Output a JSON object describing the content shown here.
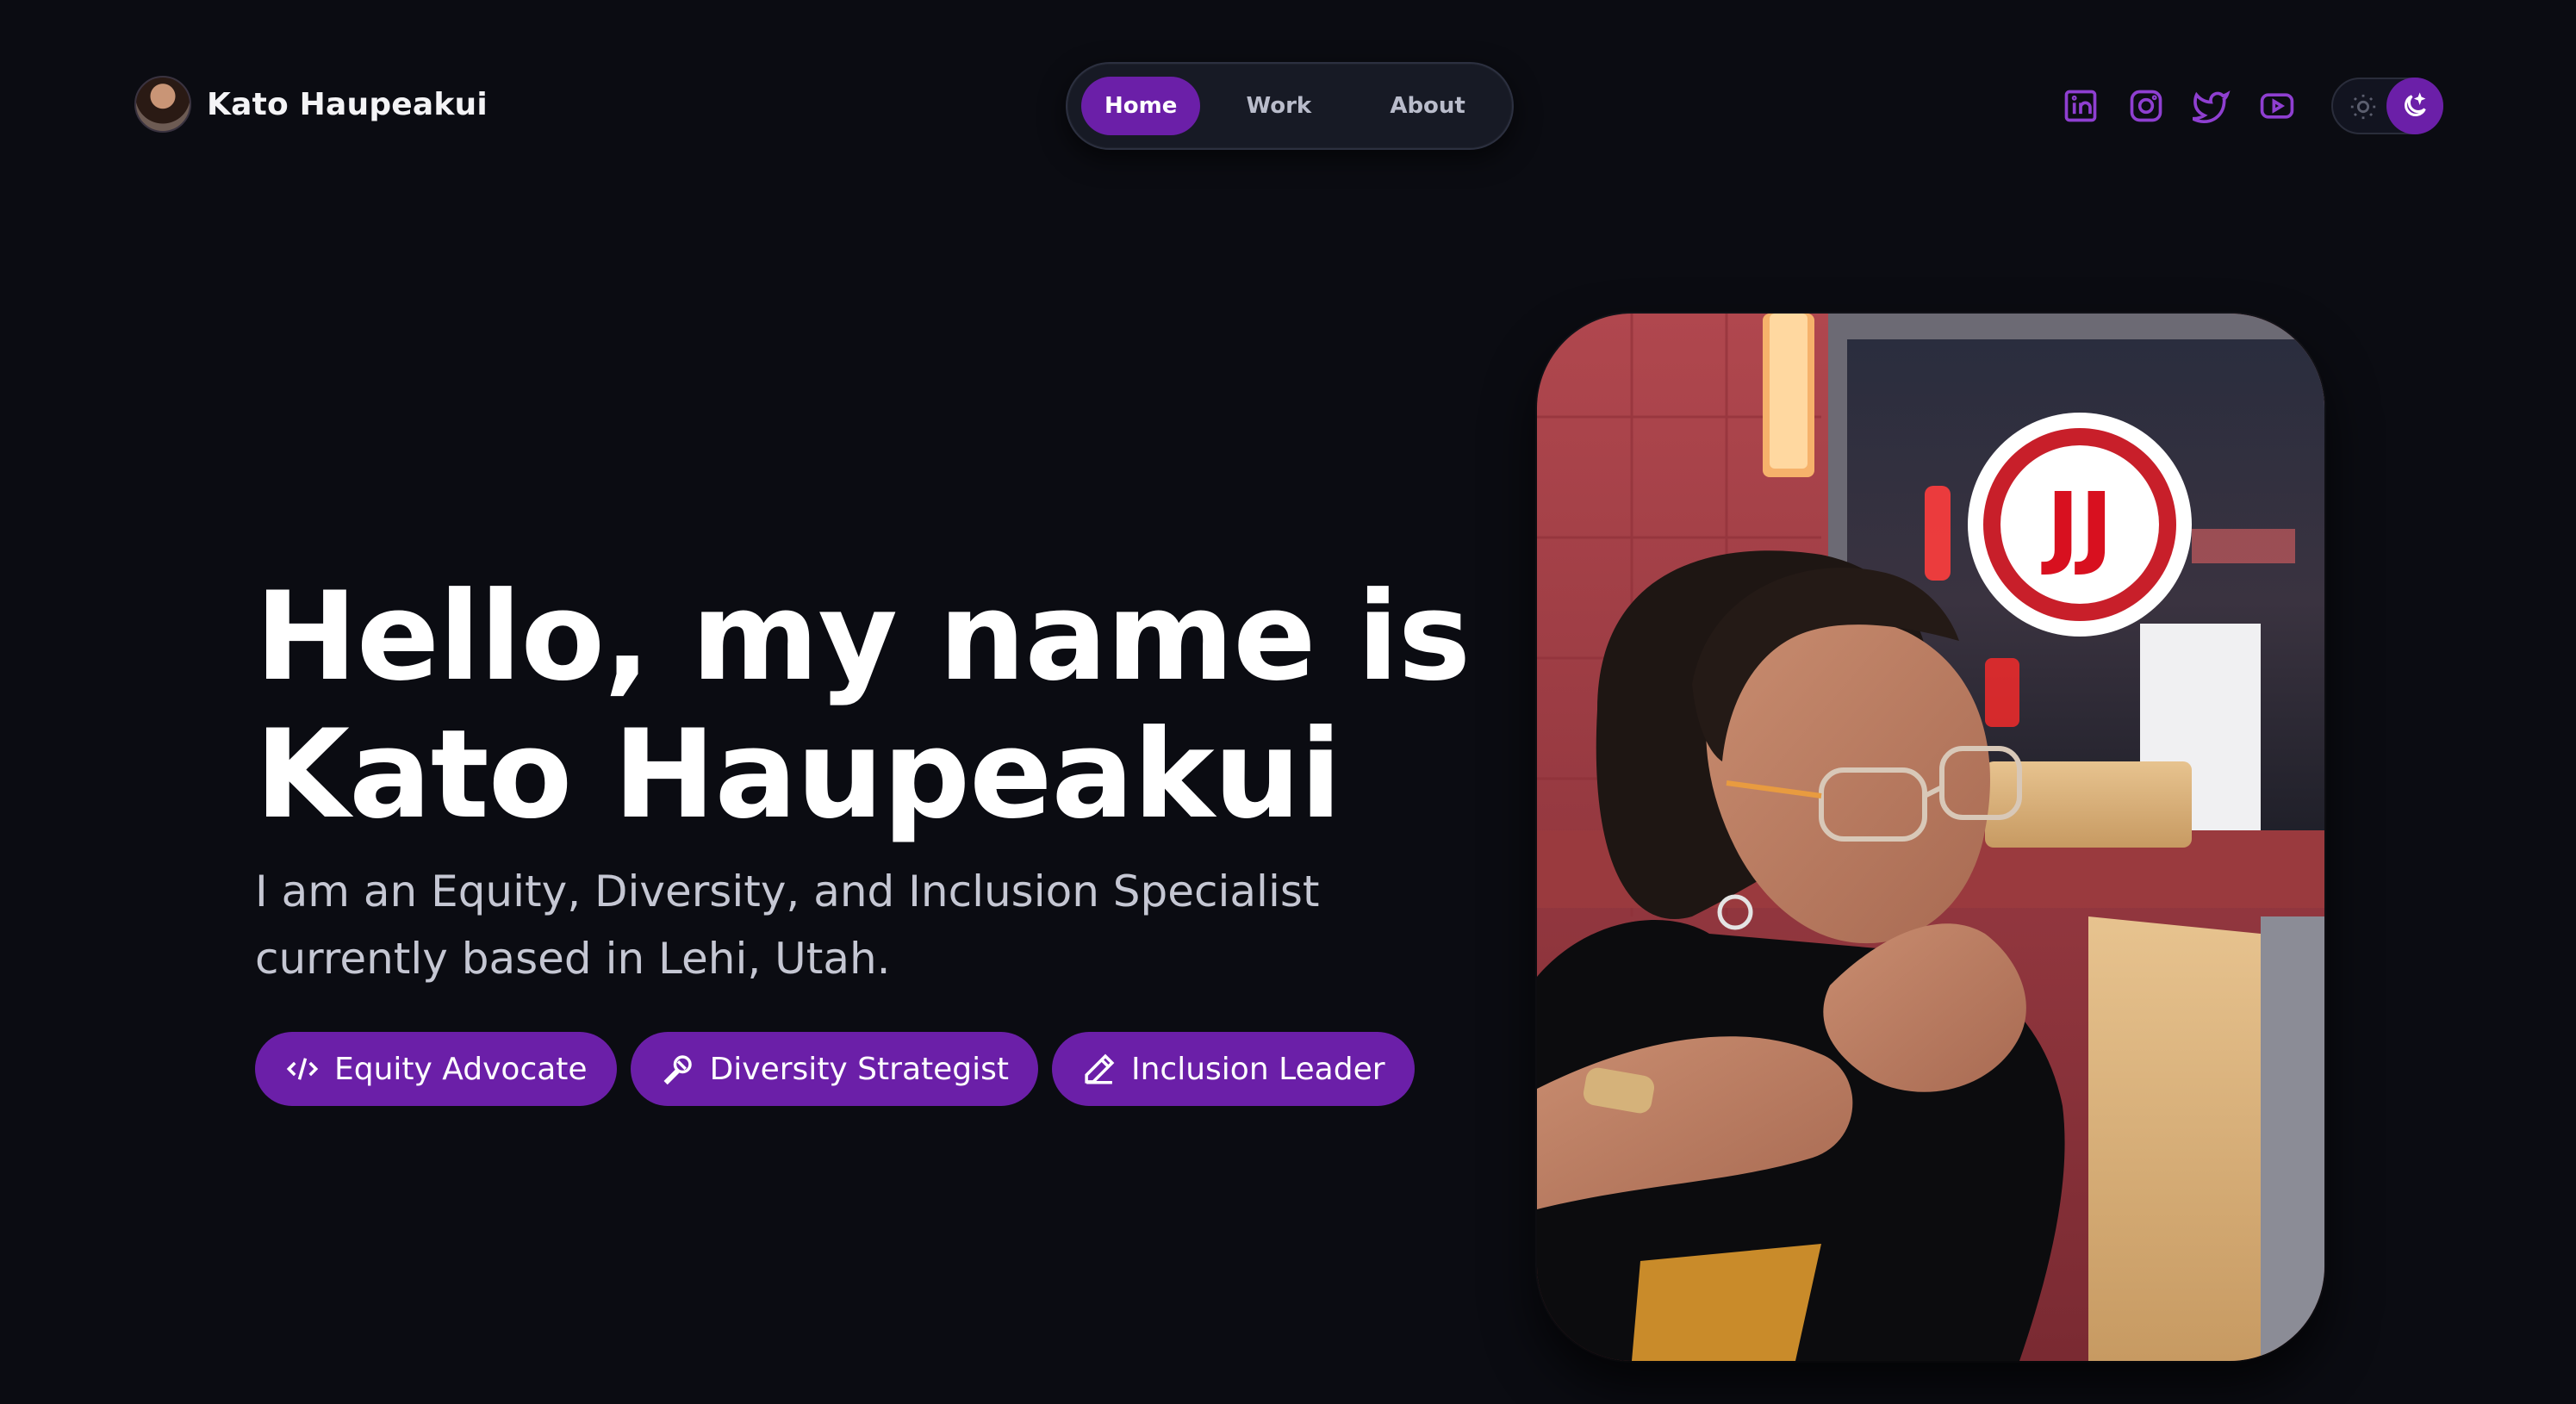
{
  "header": {
    "brand_name": "Kato Haupeakui",
    "nav": [
      {
        "label": "Home",
        "active": true
      },
      {
        "label": "Work",
        "active": false
      },
      {
        "label": "About",
        "active": false
      }
    ],
    "socials": [
      {
        "icon": "linkedin-icon"
      },
      {
        "icon": "instagram-icon"
      },
      {
        "icon": "twitter-icon"
      },
      {
        "icon": "youtube-icon"
      }
    ],
    "theme": {
      "mode": "dark"
    }
  },
  "hero": {
    "title_line1": "Hello, my name is",
    "title_line2": "Kato Haupeakui",
    "subtitle": "I am an Equity, Diversity, and Inclusion Specialist currently based in Lehi, Utah.",
    "tags": [
      {
        "label": "Equity Advocate",
        "icon": "code-icon"
      },
      {
        "label": "Diversity Strategist",
        "icon": "microphone-icon"
      },
      {
        "label": "Inclusion Leader",
        "icon": "pencil-icon"
      }
    ],
    "photo_sign_text": "JJ"
  },
  "colors": {
    "background": "#0b0c12",
    "accent": "#6b1fa8",
    "icon_accent": "#8f3fd1",
    "text_muted": "#c5c7d3"
  }
}
